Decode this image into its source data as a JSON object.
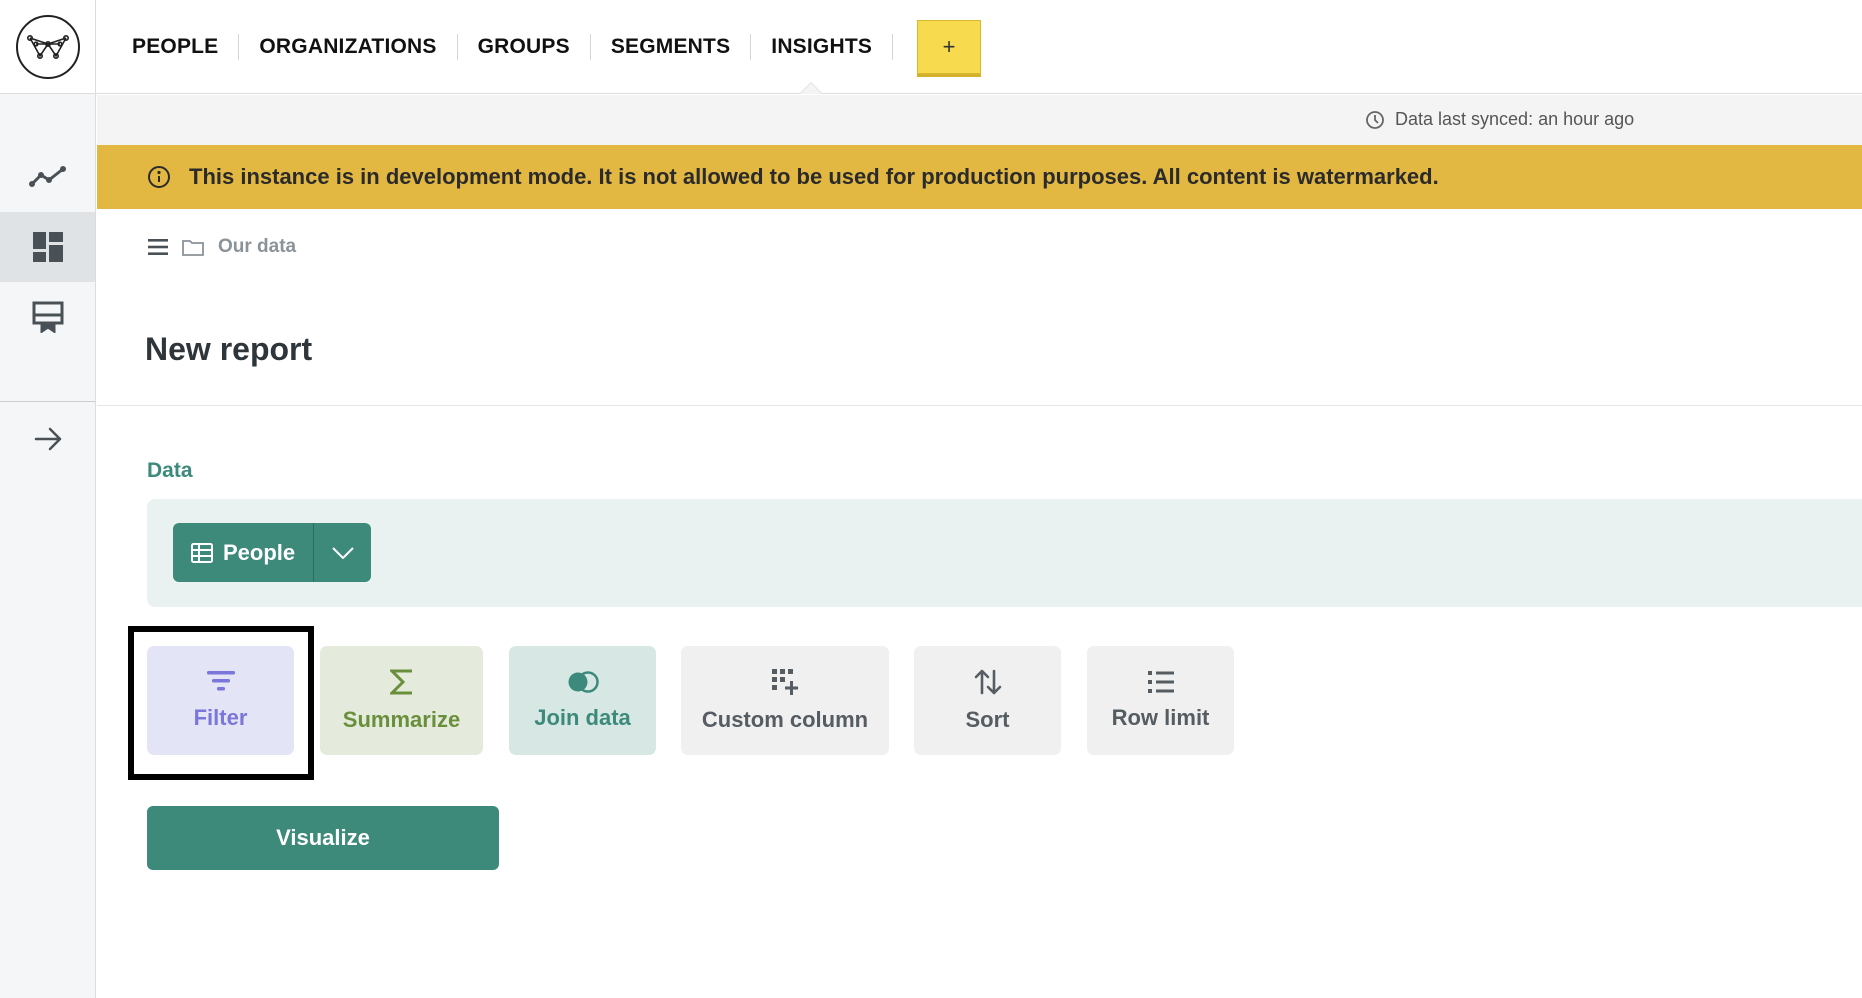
{
  "nav": {
    "items": [
      {
        "label": "PEOPLE"
      },
      {
        "label": "ORGANIZATIONS"
      },
      {
        "label": "GROUPS"
      },
      {
        "label": "SEGMENTS"
      },
      {
        "label": "INSIGHTS",
        "active": true
      }
    ],
    "plus_label": "+"
  },
  "sidebar": {
    "items": [
      {
        "icon": "trend-line-icon"
      },
      {
        "icon": "dashboard-grid-icon",
        "active": true
      },
      {
        "icon": "presentation-board-icon"
      }
    ],
    "expand_icon": "arrow-right-icon"
  },
  "sync": {
    "text": "Data last synced: an hour ago"
  },
  "banner": {
    "text": "This instance is in development mode. It is not allowed to be used for production purposes. All content is watermarked."
  },
  "breadcrumb": {
    "folder": "Our data"
  },
  "page": {
    "title": "New report"
  },
  "data_section": {
    "label": "Data",
    "table": "People"
  },
  "actions": {
    "filter": "Filter",
    "summarize": "Summarize",
    "join": "Join data",
    "custom": "Custom column",
    "sort": "Sort",
    "row_limit": "Row limit"
  },
  "visualize": {
    "label": "Visualize"
  },
  "colors": {
    "accent": "#3d8a7b",
    "banner": "#e2b843",
    "filter": "#7b76d9",
    "summarize": "#6a8f3c"
  }
}
